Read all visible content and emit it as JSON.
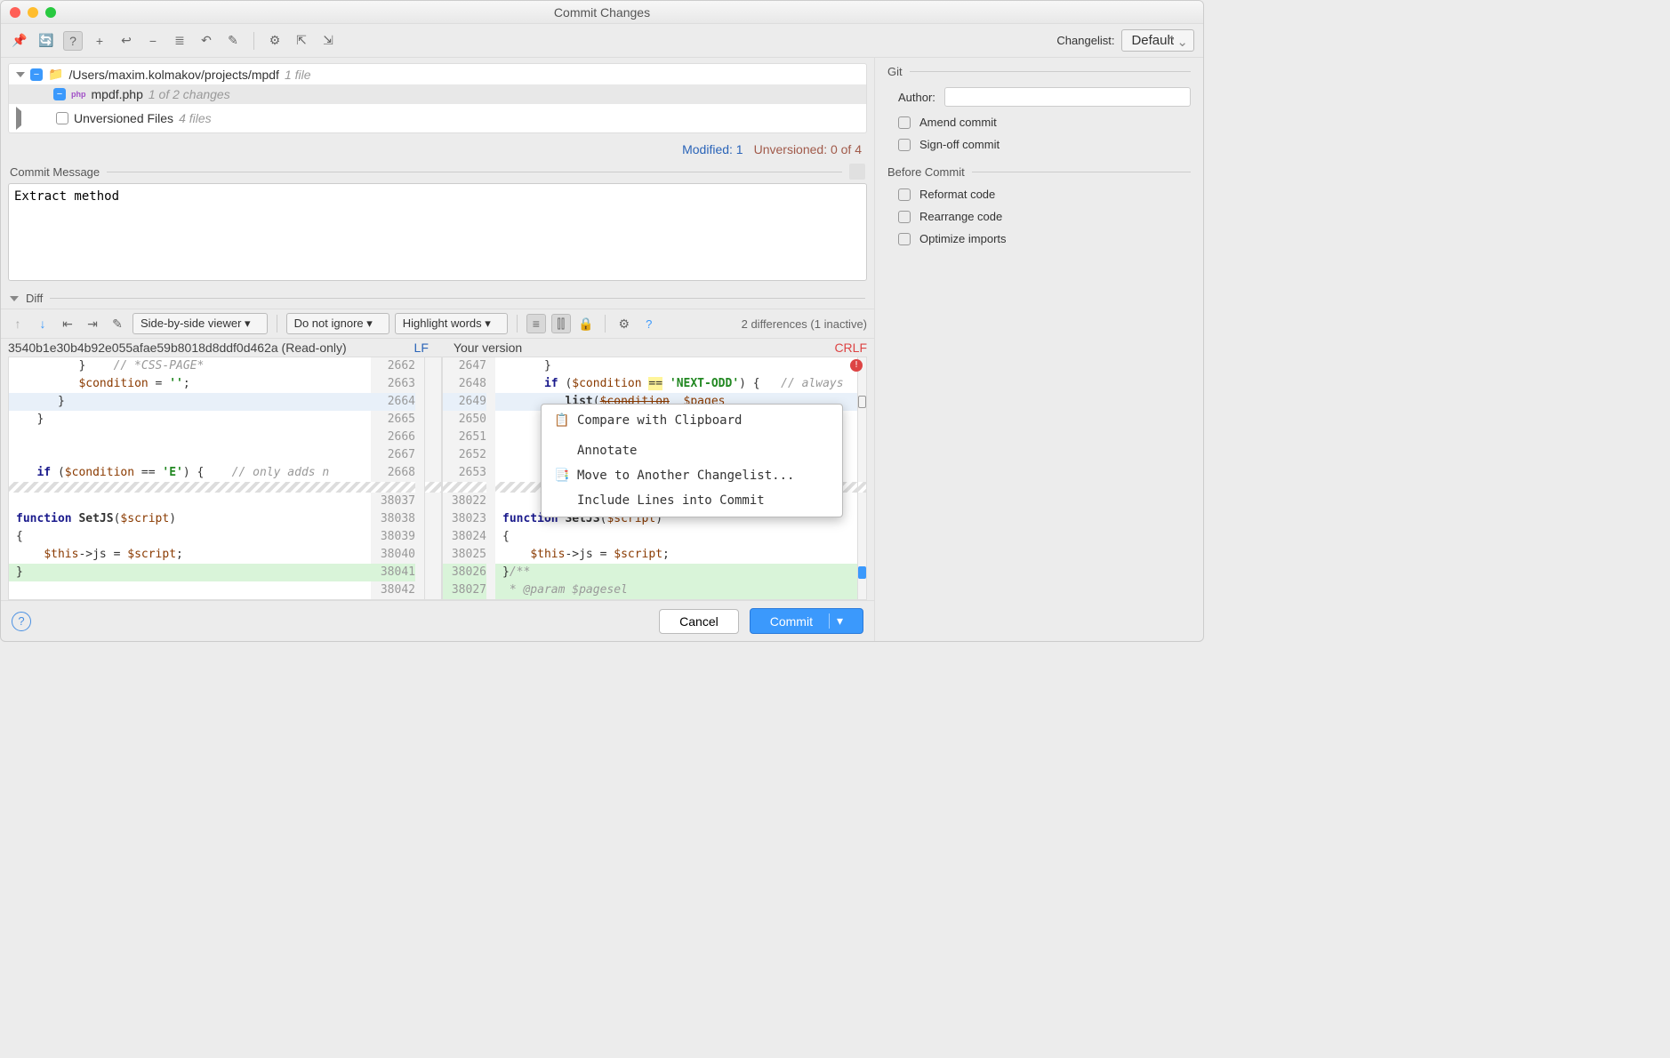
{
  "window": {
    "title": "Commit Changes"
  },
  "toolbar": {
    "changelist_label": "Changelist:",
    "changelist_value": "Default"
  },
  "tree": {
    "root_path": "/Users/maxim.kolmakov/projects/mpdf",
    "root_suffix": "1 file",
    "file_name": "mpdf.php",
    "file_suffix": "1 of 2 changes",
    "unversioned_label": "Unversioned Files",
    "unversioned_suffix": "4 files"
  },
  "status": {
    "modified": "Modified: 1",
    "unversioned": "Unversioned: 0 of 4"
  },
  "commit_msg": {
    "label": "Commit Message",
    "text": "Extract method"
  },
  "right_panel": {
    "git_label": "Git",
    "author_label": "Author:",
    "author_value": "",
    "amend": "Amend commit",
    "signoff": "Sign-off commit",
    "before_label": "Before Commit",
    "reformat": "Reformat code",
    "rearrange": "Rearrange code",
    "optimize": "Optimize imports"
  },
  "diff": {
    "label": "Diff",
    "viewer": "Side-by-side viewer",
    "ignore": "Do not ignore",
    "highlight": "Highlight words",
    "count": "2 differences (1 inactive)",
    "left_header": "3540b1e30b4b92e055afae59b8018d8ddf0d462a (Read-only)",
    "left_enc": "LF",
    "right_header": "Your version",
    "right_enc": "CRLF",
    "left_lines": [
      "2662",
      "2663",
      "2664",
      "2665",
      "2666",
      "2667",
      "2668"
    ],
    "left_lines2": [
      "38037",
      "38038",
      "38039",
      "38040",
      "38041",
      "38042"
    ],
    "right_lines": [
      "2647",
      "2648",
      "2649",
      "2650",
      "2651",
      "2652",
      "2653"
    ],
    "right_lines2": [
      "38022",
      "38023",
      "38024",
      "38025",
      "38026",
      "38027"
    ]
  },
  "context_menu": {
    "compare": "Compare with Clipboard",
    "annotate": "Annotate",
    "move": "Move to Another Changelist...",
    "include": "Include Lines into Commit"
  },
  "footer": {
    "cancel": "Cancel",
    "commit": "Commit"
  }
}
